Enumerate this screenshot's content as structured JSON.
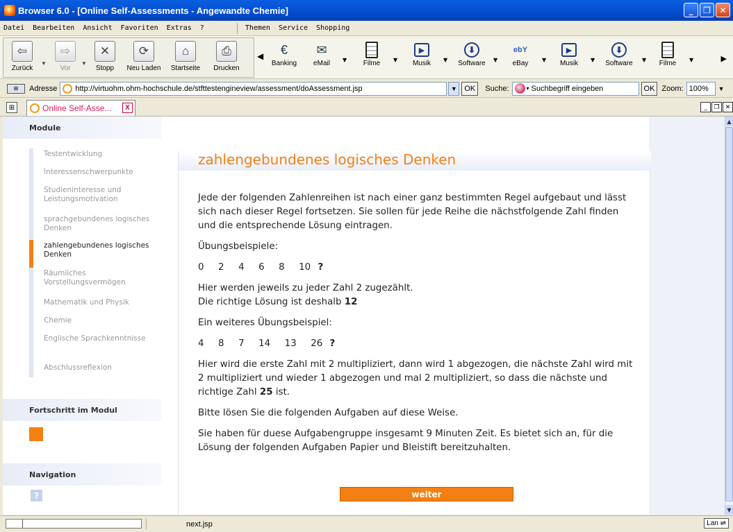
{
  "window": {
    "title": "Browser 6.0 - [Online Self-Assessments - Angewandte Chemie]",
    "buttons": [
      "_",
      "❐",
      "✕"
    ]
  },
  "menu": {
    "left": [
      "Datei",
      "Bearbeiten",
      "Ansicht",
      "Favoriten",
      "Extras",
      "?"
    ],
    "right": [
      "Themen",
      "Service",
      "Shopping"
    ]
  },
  "toolbar": {
    "nav": [
      {
        "label": "Zurück",
        "icon": "back-arrow-icon",
        "glyph": "⇦"
      },
      {
        "label": "Vor",
        "icon": "forward-arrow-icon",
        "glyph": "⇨"
      },
      {
        "label": "Stopp",
        "icon": "stop-icon",
        "glyph": "✕"
      },
      {
        "label": "Neu Laden",
        "icon": "reload-icon",
        "glyph": "⟳"
      },
      {
        "label": "Startseite",
        "icon": "home-icon",
        "glyph": "⌂"
      },
      {
        "label": "Drucken",
        "icon": "print-icon",
        "glyph": "⎙"
      }
    ],
    "quick": [
      {
        "label": "Banking",
        "icon": "banking-icon",
        "glyph": "€"
      },
      {
        "label": "eMail",
        "icon": "email-icon",
        "glyph": "✉"
      },
      {
        "label": "Filme",
        "icon": "film-icon",
        "glyph": ""
      },
      {
        "label": "Musik",
        "icon": "play-icon",
        "glyph": "▶"
      },
      {
        "label": "Software",
        "icon": "download-icon",
        "glyph": "⬇"
      },
      {
        "label": "eBay",
        "icon": "ebay-icon",
        "glyph": "ebY"
      },
      {
        "label": "Musik",
        "icon": "play-icon",
        "glyph": "▶"
      },
      {
        "label": "Software",
        "icon": "download-icon",
        "glyph": "⬇"
      },
      {
        "label": "Filme",
        "icon": "film-icon",
        "glyph": ""
      }
    ]
  },
  "address": {
    "label": "Adresse",
    "url": "http://virtuohm.ohm-hochschule.de/stfttestengineview/assessment/doAssessment.jsp",
    "ok": "OK",
    "search_label": "Suche:",
    "search_placeholder": "Suchbegriff eingeben",
    "search_ok": "OK",
    "zoom_label": "Zoom:",
    "zoom_value": "100%"
  },
  "tab": {
    "title": "Online Self-Asse...",
    "close": "X"
  },
  "sidebar": {
    "modules_heading": "Module",
    "items": [
      {
        "label": "Testentwicklung",
        "active": false
      },
      {
        "label": "Interessenschwerpunkte",
        "active": false
      },
      {
        "label": "Studieninteresse und Leistungsmotivation",
        "active": false
      },
      {
        "label": "sprachgebundenes logisches Denken",
        "active": false
      },
      {
        "label": "zahlengebundenes logisches Denken",
        "active": true
      },
      {
        "label": "Räumliches Vorstellungsvermögen",
        "active": false
      },
      {
        "label": "Mathematik und Physik",
        "active": false
      },
      {
        "label": "Chemie",
        "active": false
      },
      {
        "label": "Englische Sprachkenntnisse",
        "active": false
      },
      {
        "label": "Abschlussreflexion",
        "active": false
      }
    ],
    "progress_heading": "Fortschritt im Modul",
    "navigation_heading": "Navigation",
    "help": "?"
  },
  "main": {
    "title": "zahlengebundenes logisches Denken",
    "intro": "Jede der folgenden Zahlenreihen ist nach einer ganz bestimmten Regel aufgebaut und lässt sich nach dieser Regel fortsetzen. Sie sollen für jede Reihe die nächstfolgende Zahl finden und die entsprechende Lösung eintragen.",
    "examples_label": "Übungsbeispiele:",
    "seq1": "0  2  4  6  8  10",
    "seq1_q": "?",
    "explain1": "Hier werden jeweils zu jeder Zahl 2 zugezählt.",
    "answer1_prefix": "Die richtige Lösung ist deshalb",
    "answer1": "12",
    "example2_label": "Ein weiteres Übungsbeispiel:",
    "seq2": "4  8  7  14  13  26",
    "seq2_q": "?",
    "explain2_prefix": "Hier wird die erste Zahl mit 2 multipliziert, dann wird 1 abgezogen, die nächste Zahl wird mit 2 multipliziert und wieder 1 abgezogen und mal 2 multipliziert, so dass die nächste und richtige Zahl",
    "answer2": "25",
    "explain2_suffix": "ist.",
    "instruction": "Bitte lösen Sie die folgenden Aufgaben auf diese Weise.",
    "time_note": "Sie haben für duese Aufgabengruppe insgesamt 9 Minuten Zeit. Es bietet sich an, für die Lösung der folgenden Aufgaben Papier und Bleistift bereitzuhalten.",
    "next_button": "weiter"
  },
  "status": {
    "text": "next.jsp",
    "network": "Lan"
  },
  "colors": {
    "accent": "#f47f12",
    "title_bar": "#0653d6",
    "sidebar_inactive": "#999999"
  }
}
